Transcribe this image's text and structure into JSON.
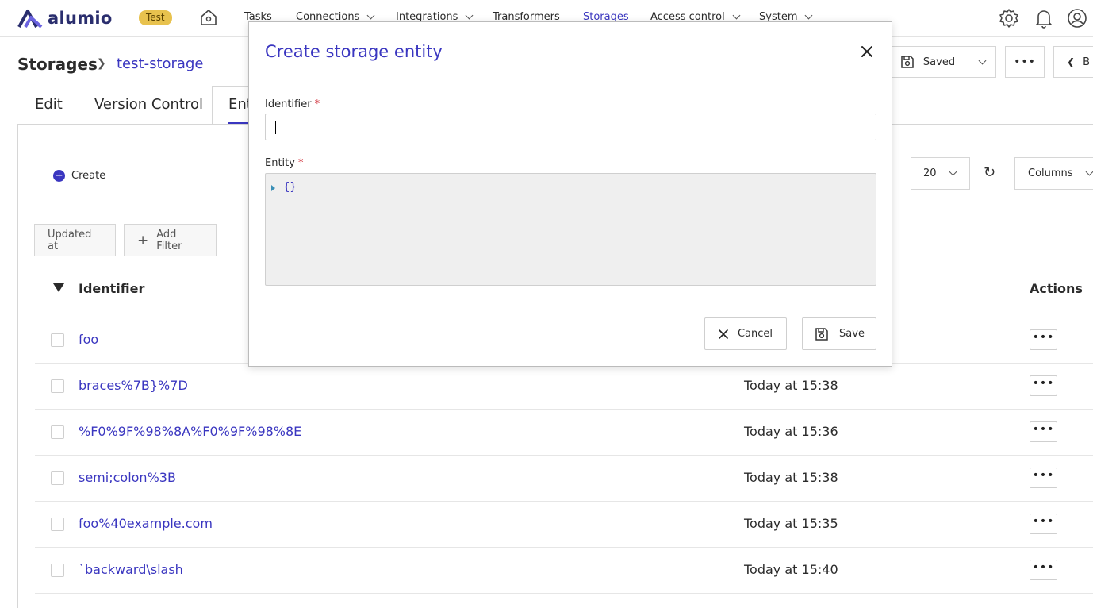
{
  "app": {
    "logo_text": "alumio",
    "env_badge": "Test"
  },
  "nav": {
    "items": [
      {
        "label": "Tasks"
      },
      {
        "label": "Connections"
      },
      {
        "label": "Integrations"
      },
      {
        "label": "Transformers"
      },
      {
        "label": "Storages",
        "active": true
      },
      {
        "label": "Access control"
      },
      {
        "label": "System"
      }
    ]
  },
  "breadcrumb": {
    "root": "Storages",
    "current": "test-storage"
  },
  "header_actions": {
    "saved_label": "Saved",
    "back_label": "B"
  },
  "tabs": [
    {
      "label": "Edit"
    },
    {
      "label": "Version Control"
    },
    {
      "label": "Ent",
      "active": true
    }
  ],
  "toolbar": {
    "create_label": "Create",
    "page_size": "20",
    "columns_label": "Columns"
  },
  "filters": {
    "updated_at_label": "Updated at",
    "add_filter_label": "Add Filter"
  },
  "table": {
    "headers": {
      "identifier": "Identifier",
      "actions": "Actions"
    },
    "rows": [
      {
        "identifier": "foo",
        "updated": ""
      },
      {
        "identifier": "braces%7B}%7D",
        "updated": "Today at 15:38"
      },
      {
        "identifier": "%F0%9F%98%8A%F0%9F%98%8E",
        "updated": "Today at 15:36"
      },
      {
        "identifier": "semi;colon%3B",
        "updated": "Today at 15:38"
      },
      {
        "identifier": "foo%40example.com",
        "updated": "Today at 15:35"
      },
      {
        "identifier": "`backward\\slash",
        "updated": "Today at 15:40"
      }
    ],
    "row_action_glyph": "•••"
  },
  "modal": {
    "title": "Create storage entity",
    "identifier_label": "Identifier",
    "identifier_value": "",
    "entity_label": "Entity",
    "required_mark": "*",
    "entity_value": "{}",
    "cancel_label": "Cancel",
    "save_label": "Save"
  },
  "colors": {
    "accent": "#3a36c0",
    "badge": "#e8c24e",
    "brand": "#2a2e6e"
  }
}
